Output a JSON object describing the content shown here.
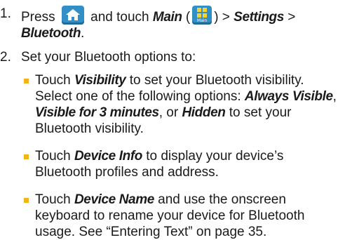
{
  "steps": [
    {
      "number": "1.",
      "text_press": "Press",
      "text_and_touch": "and touch",
      "main_label": "Main",
      "open_paren": "(",
      "main_icon_caption": "Main",
      "close_paren": ") >",
      "settings_label": "Settings",
      "gt": ">",
      "bluetooth_label": "Bluetooth",
      "period": "."
    },
    {
      "number": "2.",
      "intro": "Set your Bluetooth options to:"
    }
  ],
  "bullets": {
    "visibility": {
      "touch": "Touch",
      "label": "Visibility",
      "text1": "to set your Bluetooth visibility. Select one of the following options:",
      "opt1": "Always Visible",
      "comma1": ",",
      "opt2": "Visible for 3 minutes",
      "or": ", or",
      "opt3": "Hidden",
      "text2": "to set your Bluetooth visibility."
    },
    "device_info": {
      "touch": "Touch",
      "label": "Device Info",
      "text": "to display your device’s Bluetooth profiles and address."
    },
    "device_name": {
      "touch": "Touch",
      "label": "Device Name",
      "text": "and use the onscreen keyboard to rename your device for Bluetooth usage. See “Entering Text” on page 35."
    }
  },
  "icons": {
    "home": "home-icon",
    "main": "main-menu-icon"
  },
  "colors": {
    "icon_blue": "#2f8fc6",
    "bullet_yellow": "#f2b21b"
  }
}
